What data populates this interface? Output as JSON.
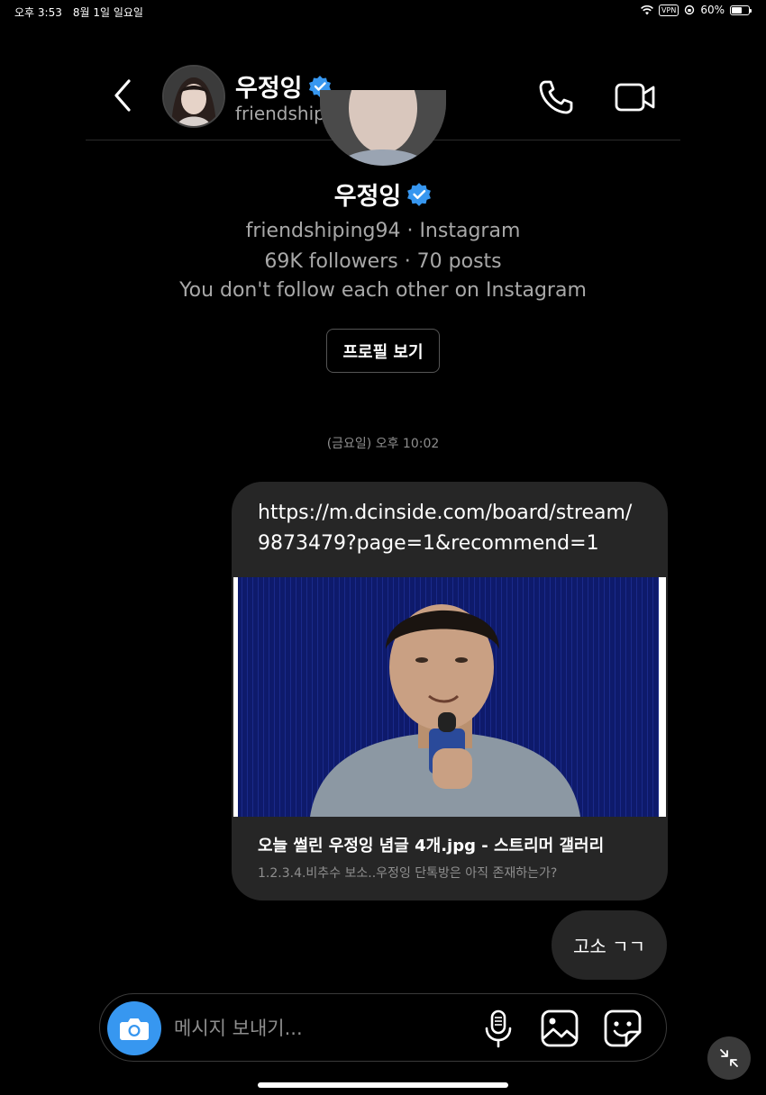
{
  "status_bar": {
    "time": "오후 3:53",
    "date": "8월 1일 일요일",
    "vpn_label": "VPN",
    "battery_text": "60%",
    "battery_level": 0.6
  },
  "header": {
    "name": "우정잉",
    "handle": "friendshiping94",
    "icons": [
      "back-chevron-icon",
      "avatar",
      "verified-badge-icon",
      "phone-icon",
      "video-camera-icon"
    ]
  },
  "profile": {
    "name": "우정잉",
    "handle_line": "friendshiping94 · Instagram",
    "stats_line": "69K followers · 70 posts",
    "relation_line": "You don't follow each other on Instagram",
    "view_profile_label": "프로필 보기"
  },
  "thread": {
    "timestamp": "(금요일) 오후 10:02",
    "link_message": {
      "url_line1": "https://m.dcinside.com/board/stream/",
      "url_line2": "9873479?page=1&recommend=1",
      "preview_title": "오늘 썰린 우정잉 념글 4개.jpg - 스트리머 갤러리",
      "preview_description": "1.2.3.4.비추수 보소..우정잉 단톡방은 아직 존재하는가?"
    },
    "text_message": "고소 ㄱㄱ"
  },
  "composer": {
    "placeholder": "메시지 보내기...",
    "icons": [
      "camera-icon",
      "microphone-icon",
      "image-icon",
      "sticker-icon"
    ]
  },
  "colors": {
    "background": "#000000",
    "bubble": "#262626",
    "accent": "#3797f0",
    "muted_text": "#a8a8a8"
  }
}
